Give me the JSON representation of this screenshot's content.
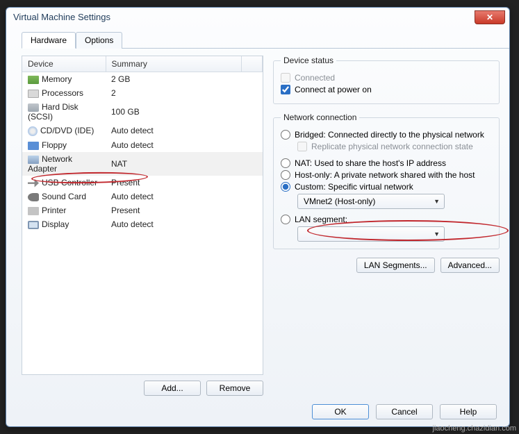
{
  "window": {
    "title": "Virtual Machine Settings"
  },
  "tabs": {
    "hardware": "Hardware",
    "options": "Options"
  },
  "deviceTable": {
    "headers": {
      "device": "Device",
      "summary": "Summary"
    },
    "rows": [
      {
        "icon": "ico-mem",
        "device": "Memory",
        "summary": "2 GB",
        "selected": false
      },
      {
        "icon": "ico-cpu",
        "device": "Processors",
        "summary": "2",
        "selected": false
      },
      {
        "icon": "ico-hdd",
        "device": "Hard Disk (SCSI)",
        "summary": "100 GB",
        "selected": false
      },
      {
        "icon": "ico-cd",
        "device": "CD/DVD (IDE)",
        "summary": "Auto detect",
        "selected": false
      },
      {
        "icon": "ico-floppy",
        "device": "Floppy",
        "summary": "Auto detect",
        "selected": false
      },
      {
        "icon": "ico-net",
        "device": "Network Adapter",
        "summary": "NAT",
        "selected": true
      },
      {
        "icon": "ico-usb",
        "device": "USB Controller",
        "summary": "Present",
        "selected": false
      },
      {
        "icon": "ico-snd",
        "device": "Sound Card",
        "summary": "Auto detect",
        "selected": false
      },
      {
        "icon": "ico-prn",
        "device": "Printer",
        "summary": "Present",
        "selected": false
      },
      {
        "icon": "ico-disp",
        "device": "Display",
        "summary": "Auto detect",
        "selected": false
      }
    ]
  },
  "leftButtons": {
    "add": "Add...",
    "remove": "Remove"
  },
  "deviceStatus": {
    "legend": "Device status",
    "connected": "Connected",
    "connectAtPowerOn": "Connect at power on"
  },
  "networkConnection": {
    "legend": "Network connection",
    "bridged": "Bridged: Connected directly to the physical network",
    "replicate": "Replicate physical network connection state",
    "nat": "NAT: Used to share the host's IP address",
    "hostOnly": "Host-only: A private network shared with the host",
    "custom": "Custom: Specific virtual network",
    "customSelectValue": "VMnet2 (Host-only)",
    "lanSegment": "LAN segment:",
    "lanSegmentSelectValue": ""
  },
  "rightButtons": {
    "lanSegments": "LAN Segments...",
    "advanced": "Advanced..."
  },
  "footer": {
    "ok": "OK",
    "cancel": "Cancel",
    "help": "Help"
  },
  "watermark": "jiaocheng.chazidian.com"
}
